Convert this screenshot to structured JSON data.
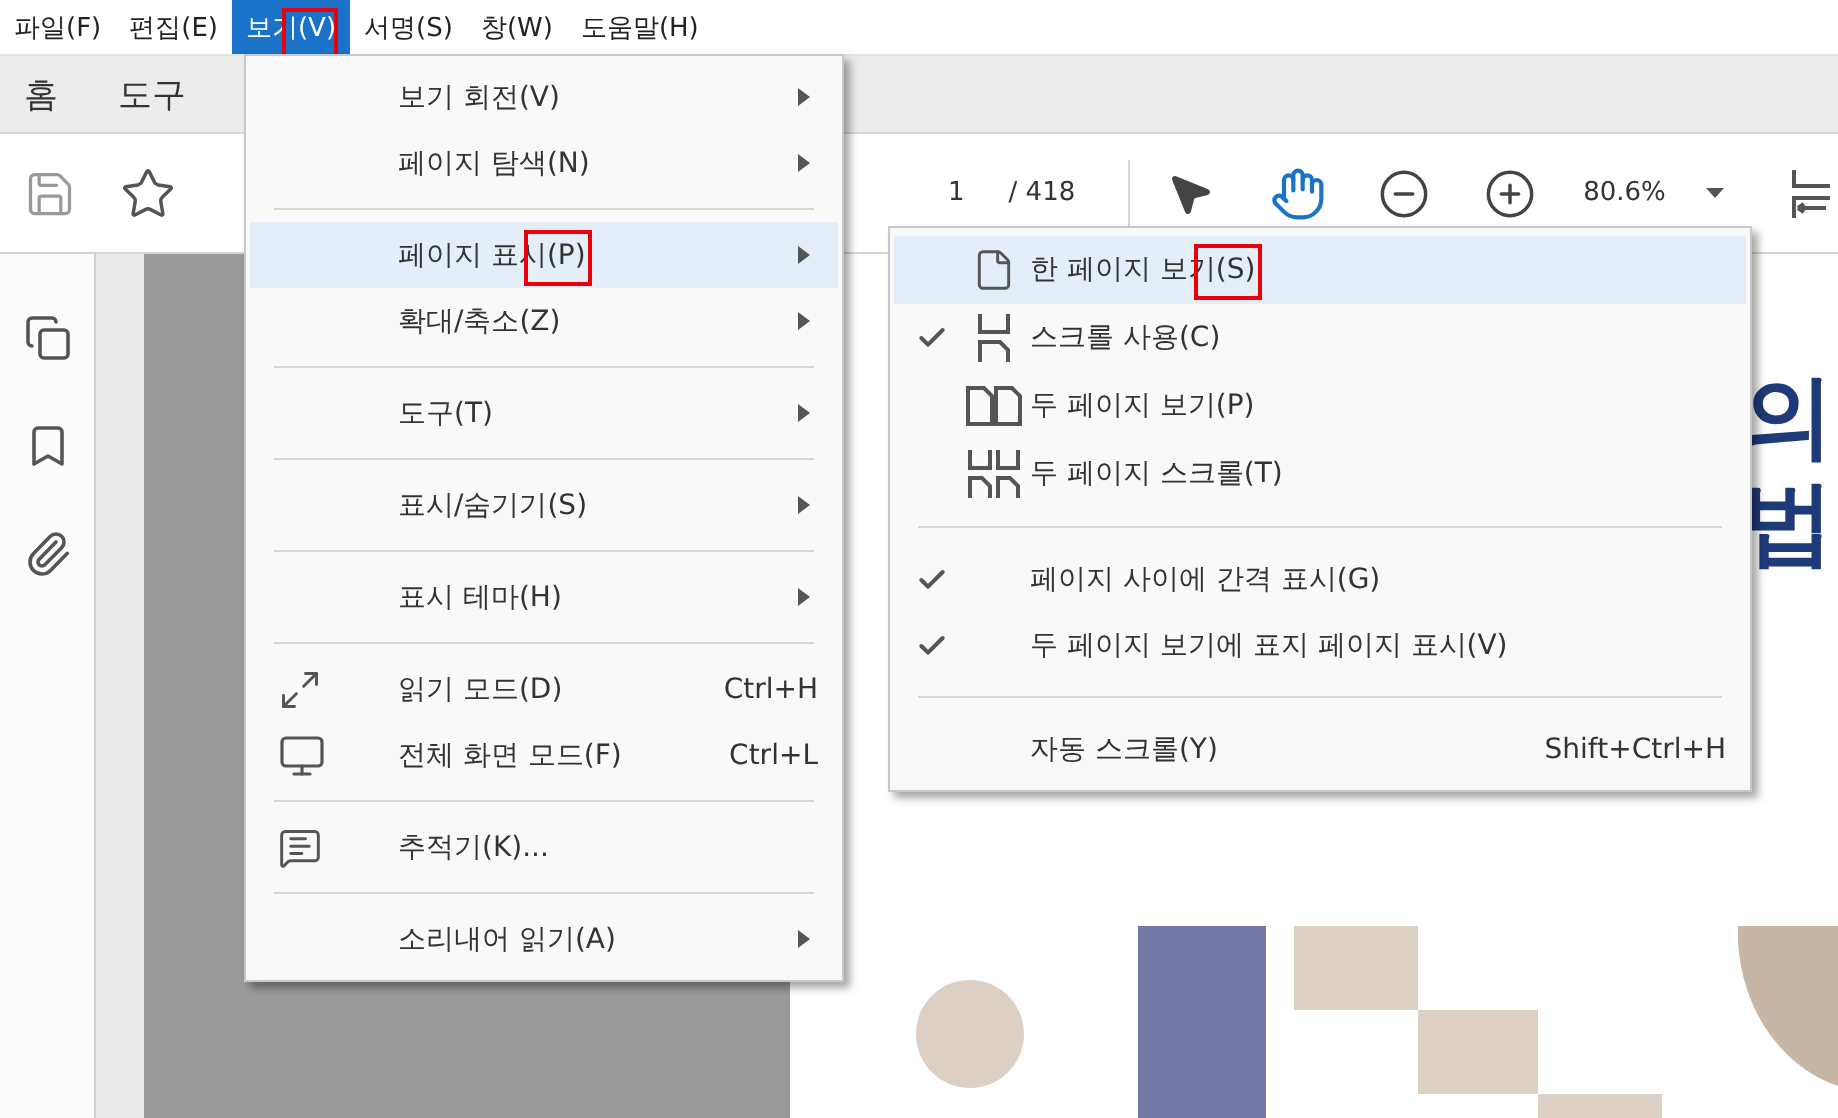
{
  "menu_bar": [
    {
      "label": "파일(F)",
      "selected": false
    },
    {
      "label": "편집(E)",
      "selected": false
    },
    {
      "label": "보기(V)",
      "selected": true,
      "marked": true
    },
    {
      "label": "서명(S)",
      "selected": false
    },
    {
      "label": "창(W)",
      "selected": false
    },
    {
      "label": "도움말(H)",
      "selected": false
    }
  ],
  "tabs": [
    {
      "label": "홈"
    },
    {
      "label": "도구"
    }
  ],
  "toolbar": {
    "page_number": "1",
    "page_total": "/ 418",
    "zoom": "80.6%"
  },
  "view_menu": {
    "groups": [
      [
        {
          "label": "보기 회전(V)",
          "submenu": true
        },
        {
          "label": "페이지 탐색(N)",
          "submenu": true
        }
      ],
      [
        {
          "label": "페이지 표시(P)",
          "submenu": true,
          "highlighted": true,
          "marked": true
        },
        {
          "label": "확대/축소(Z)",
          "submenu": true
        }
      ],
      [
        {
          "label": "도구(T)",
          "submenu": true
        }
      ],
      [
        {
          "label": "표시/숨기기(S)",
          "submenu": true
        }
      ],
      [
        {
          "label": "표시 테마(H)",
          "submenu": true
        }
      ],
      [
        {
          "label": "읽기 모드(D)",
          "icon": true,
          "shortcut": "Ctrl+H"
        },
        {
          "label": "전체 화면 모드(F)",
          "icon": true,
          "shortcut": "Ctrl+L"
        }
      ],
      [
        {
          "label": "추적기(K)...",
          "icon": true
        }
      ],
      [
        {
          "label": "소리내어 읽기(A)",
          "submenu": true
        }
      ]
    ]
  },
  "page_display_menu": {
    "groups": [
      [
        {
          "label": "한 페이지 보기(S)",
          "icon": true,
          "checked": false,
          "highlighted": true,
          "marked": true
        },
        {
          "label": "스크롤 사용(C)",
          "icon": true,
          "checked": true
        },
        {
          "label": "두 페이지 보기(P)",
          "icon": true,
          "checked": false
        },
        {
          "label": "두 페이지 스크롤(T)",
          "icon": true,
          "checked": false
        }
      ],
      [
        {
          "label": "페이지 사이에 간격 표시(G)",
          "checked": true
        },
        {
          "label": "두 페이지 보기에 표지 페이지 표시(V)",
          "checked": true
        }
      ],
      [
        {
          "label": "자동 스크롤(Y)",
          "checked": false,
          "shortcut": "Shift+Ctrl+H"
        }
      ]
    ]
  },
  "document": {
    "heading_lines": [
      "의",
      "법"
    ]
  }
}
